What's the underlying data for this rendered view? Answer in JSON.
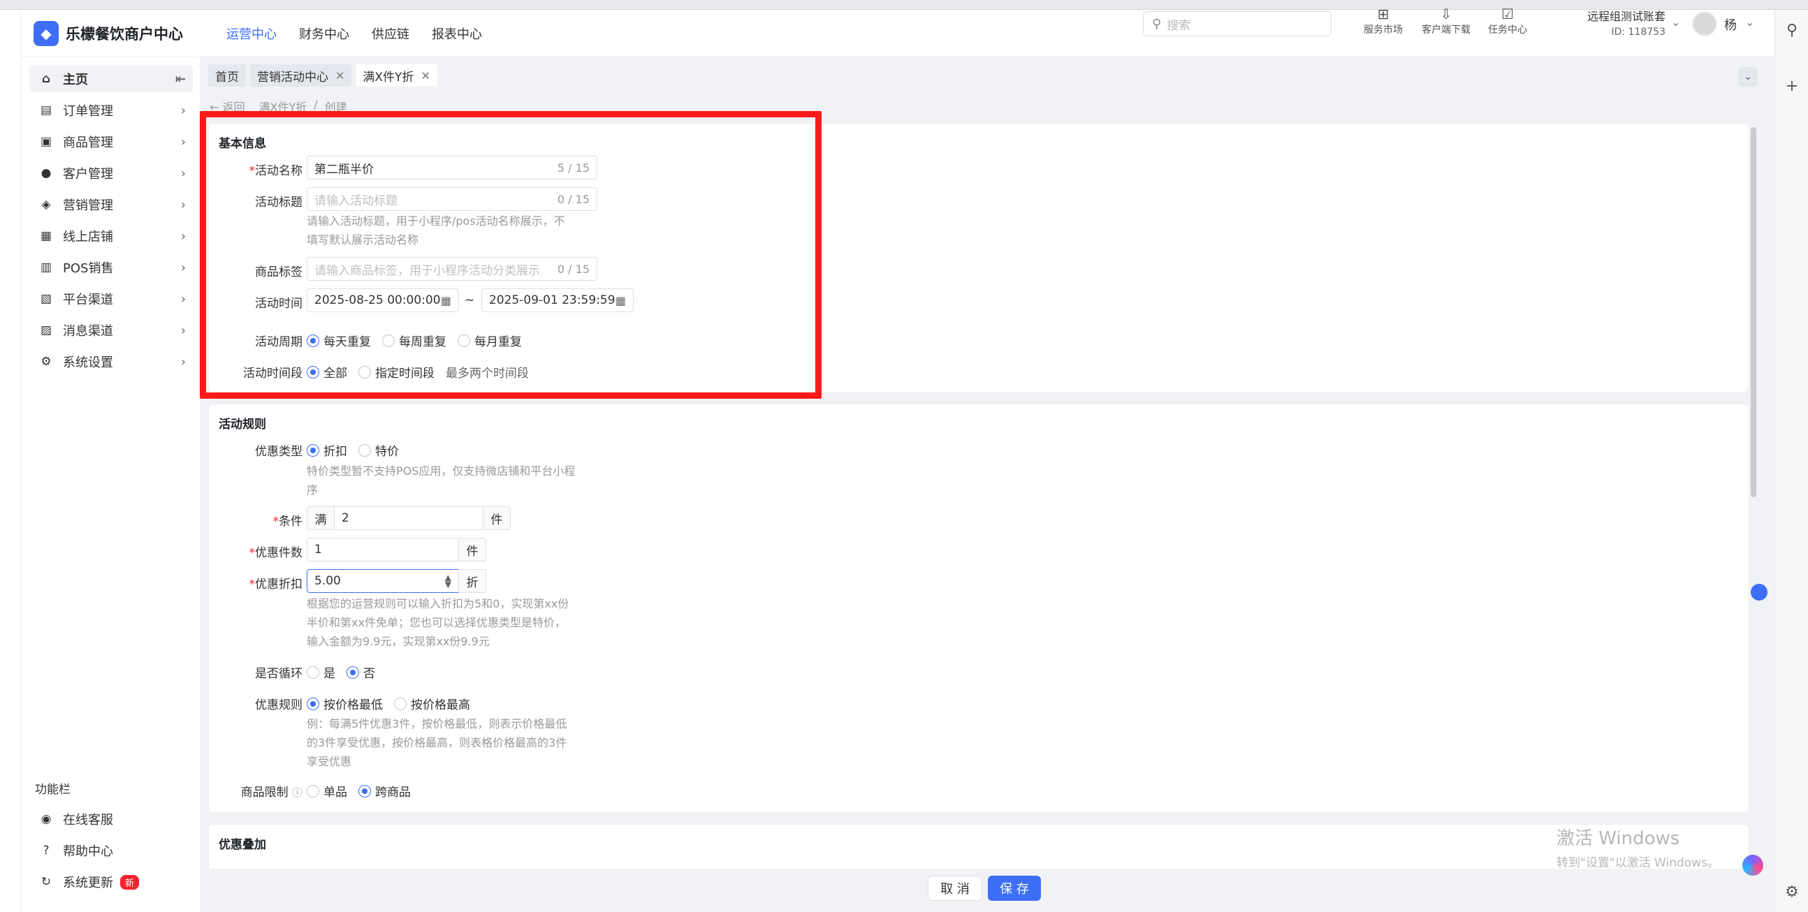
{
  "header": {
    "app_name": "乐檬餐饮商户中心",
    "nav": [
      "运营中心",
      "财务中心",
      "供应链",
      "报表中心"
    ],
    "search_placeholder": "搜索",
    "tools": [
      "服务市场",
      "客户端下载",
      "任务中心"
    ],
    "account_name": "远程组测试账套",
    "account_id": "ID: 118753",
    "user": "杨"
  },
  "sidebar": {
    "items": [
      {
        "label": "主页",
        "icon": "home-icon"
      },
      {
        "label": "订单管理",
        "icon": "order-icon"
      },
      {
        "label": "商品管理",
        "icon": "goods-icon"
      },
      {
        "label": "客户管理",
        "icon": "customer-icon"
      },
      {
        "label": "营销管理",
        "icon": "tag-icon"
      },
      {
        "label": "线上店铺",
        "icon": "shop-icon"
      },
      {
        "label": "POS销售",
        "icon": "pos-icon"
      },
      {
        "label": "平台渠道",
        "icon": "platform-icon"
      },
      {
        "label": "消息渠道",
        "icon": "message-icon"
      },
      {
        "label": "系统设置",
        "icon": "gear-icon"
      }
    ],
    "tools_title": "功能栏",
    "tools": [
      {
        "label": "在线客服",
        "icon": "service-icon"
      },
      {
        "label": "帮助中心",
        "icon": "help-icon"
      },
      {
        "label": "系统更新",
        "icon": "refresh-icon",
        "badge": "新"
      }
    ]
  },
  "tabs": [
    {
      "label": "首页"
    },
    {
      "label": "营销活动中心"
    },
    {
      "label": "满X件Y折"
    }
  ],
  "breadcrumb": {
    "back": "返回",
    "path": "满X件Y折",
    "sep": "/",
    "current": "创建"
  },
  "basic": {
    "title": "基本信息",
    "name_label": "活动名称",
    "name_value": "第二瓶半价",
    "name_count": "5 / 15",
    "title_label": "活动标题",
    "title_placeholder": "请输入活动标题",
    "title_count": "0 / 15",
    "title_help1": "请输入活动标题，用于小程序/pos活动名称展示，不",
    "title_help2": "填写默认展示活动名称",
    "tag_label": "商品标签",
    "tag_placeholder": "请输入商品标签，用于小程序活动分类展示",
    "tag_count": "0 / 15",
    "time_label": "活动时间",
    "time_start": "2025-08-25 00:00:00",
    "time_sep": "~",
    "time_end": "2025-09-01 23:59:59",
    "cycle_label": "活动周期",
    "cycle_options": [
      "每天重复",
      "每周重复",
      "每月重复"
    ],
    "period_label": "活动时间段",
    "period_options": [
      "全部",
      "指定时间段"
    ],
    "period_note": "最多两个时间段"
  },
  "rules": {
    "title": "活动规则",
    "type_label": "优惠类型",
    "type_options": [
      "折扣",
      "特价"
    ],
    "type_help1": "特价类型暂不支持POS应用，仅支持微店铺和平台小程",
    "type_help2": "序",
    "cond_label": "条件",
    "cond_prefix": "满",
    "cond_value": "2",
    "cond_suffix": "件",
    "qty_label": "优惠件数",
    "qty_value": "1",
    "qty_suffix": "件",
    "discount_label": "优惠折扣",
    "discount_value": "5.00",
    "discount_suffix": "折",
    "discount_help1": "根据您的运营规则可以输入折扣为5和0，实现第xx份",
    "discount_help2": "半价和第xx件免单；您也可以选择优惠类型是特价，",
    "discount_help3": "输入金额为9.9元，实现第xx份9.9元",
    "loop_label": "是否循环",
    "loop_options": [
      "是",
      "否"
    ],
    "rule_label": "优惠规则",
    "rule_options": [
      "按价格最低",
      "按价格最高"
    ],
    "rule_help1": "例：每满5件优惠3件，按价格最低，则表示价格最低",
    "rule_help2": "的3件享受优惠，按价格最高，则表格价格最高的3件",
    "rule_help3": "享受优惠",
    "limit_label": "商品限制",
    "limit_options": [
      "单品",
      "跨商品"
    ]
  },
  "stack": {
    "title": "优惠叠加"
  },
  "footer": {
    "cancel": "取 消",
    "save": "保 存"
  },
  "watermark": {
    "line1": "激活 Windows",
    "line2": "转到\"设置\"以激活 Windows。"
  },
  "accent_color": "#3d6ef5",
  "highlight_color": "#ff1a1a"
}
